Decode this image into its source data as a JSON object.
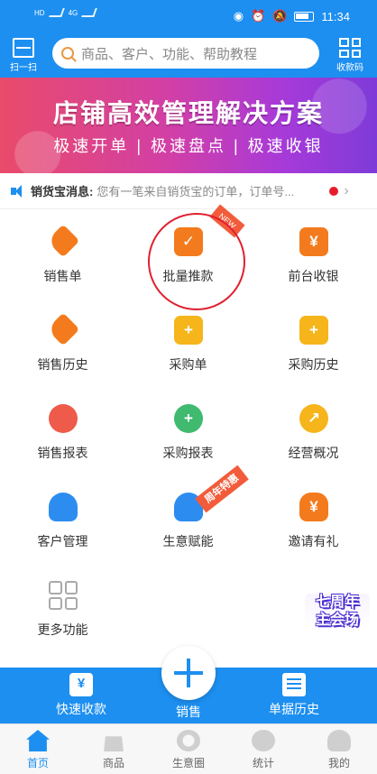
{
  "status_bar": {
    "left_labels": [
      "HD",
      "4G",
      "HD",
      "4G"
    ],
    "time": "11:34"
  },
  "header": {
    "scan_label": "扫一扫",
    "search_placeholder": "商品、客户、功能、帮助教程",
    "qr_label": "收款码"
  },
  "banner": {
    "title": "店铺高效管理解决方案",
    "subtitle": "极速开单 | 极速盘点 | 极速收银"
  },
  "notice": {
    "title": "销货宝消息:",
    "message": "您有一笔来自销货宝的订单，订单号..."
  },
  "grid": [
    {
      "label": "销售单",
      "icon": "tag-icon",
      "color": "#f37b1d"
    },
    {
      "label": "批量推款",
      "icon": "clipboard-share-icon",
      "color": "#f37b1d",
      "ribbon": "NEW"
    },
    {
      "label": "前台收银",
      "icon": "cashier-icon",
      "color": "#f37b1d",
      "glyph": "¥"
    },
    {
      "label": "销售历史",
      "icon": "tag-history-icon",
      "color": "#f37b1d"
    },
    {
      "label": "采购单",
      "icon": "purchase-bag-icon",
      "color": "#f5b51b",
      "glyph": "+"
    },
    {
      "label": "采购历史",
      "icon": "purchase-history-icon",
      "color": "#f5b51b",
      "glyph": "+"
    },
    {
      "label": "销售报表",
      "icon": "sales-report-icon",
      "color": "#ee5b4a"
    },
    {
      "label": "采购报表",
      "icon": "purchase-report-icon",
      "color": "#3fba6f",
      "glyph": "+"
    },
    {
      "label": "经营概况",
      "icon": "business-chart-icon",
      "color": "#f5b51b"
    },
    {
      "label": "客户管理",
      "icon": "customer-icon",
      "color": "#2d8cf0"
    },
    {
      "label": "生意赋能",
      "icon": "empower-icon",
      "color": "#2d8cf0",
      "ribbon": "周年特惠"
    },
    {
      "label": "邀请有礼",
      "icon": "gift-bag-icon",
      "color": "#f37b1d",
      "glyph": "¥"
    },
    {
      "label": "更多功能",
      "icon": "more-grid-icon",
      "color": "#aaaaaa"
    }
  ],
  "anniversary_badge": "七周年\n主会场",
  "action_bar": {
    "quick_receipt": "快速收款",
    "sale": "销售",
    "order_history": "单据历史"
  },
  "tabbar": [
    "首页",
    "商品",
    "生意圈",
    "统计",
    "我的"
  ],
  "colors": {
    "primary": "#1d8ff0",
    "orange": "#f37b1d",
    "highlight_circle": "#e0202f"
  }
}
